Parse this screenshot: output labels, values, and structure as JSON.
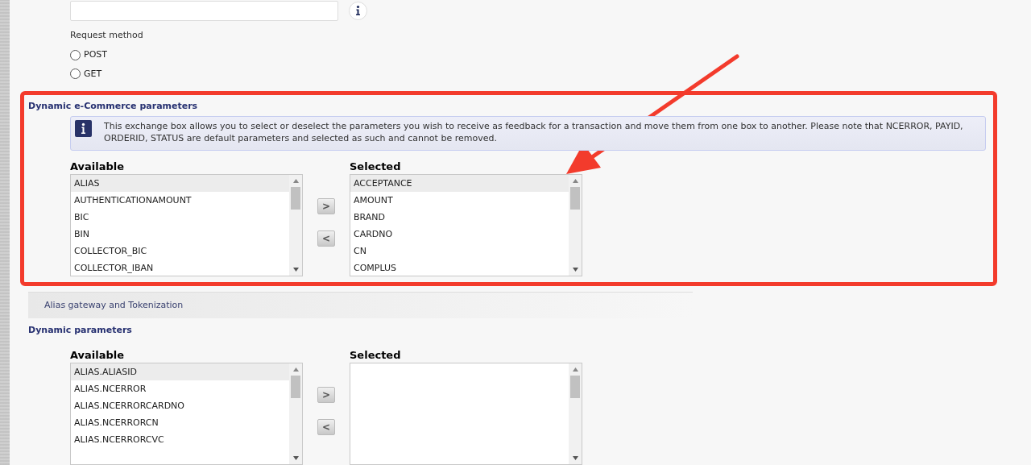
{
  "request_method": {
    "label": "Request method",
    "options": [
      {
        "label": "POST",
        "selected": false
      },
      {
        "label": "GET",
        "selected": false
      }
    ]
  },
  "ecommerce": {
    "title": "Dynamic e-Commerce parameters",
    "info": "This exchange box allows you to select or deselect the parameters you wish to receive as feedback for a transaction and move them from one box to another. Please note that NCERROR, PAYID, ORDERID, STATUS are default parameters and selected as such and cannot be removed.",
    "available": {
      "label": "Available",
      "items": [
        {
          "text": "ALIAS",
          "selected": true
        },
        {
          "text": "AUTHENTICATIONAMOUNT",
          "selected": false
        },
        {
          "text": "BIC",
          "selected": false
        },
        {
          "text": "BIN",
          "selected": false
        },
        {
          "text": "COLLECTOR_BIC",
          "selected": false
        },
        {
          "text": "COLLECTOR_IBAN",
          "selected": false
        }
      ]
    },
    "add_button": ">",
    "remove_button": "<",
    "selected_list": {
      "label": "Selected",
      "items": [
        {
          "text": "ACCEPTANCE",
          "selected": true
        },
        {
          "text": "AMOUNT",
          "selected": false
        },
        {
          "text": "BRAND",
          "selected": false
        },
        {
          "text": "CARDNO",
          "selected": false
        },
        {
          "text": "CN",
          "selected": false
        },
        {
          "text": "COMPLUS",
          "selected": false
        }
      ]
    }
  },
  "alias_tab": "Alias gateway and Tokenization",
  "dynamic": {
    "title": "Dynamic parameters",
    "available": {
      "label": "Available",
      "items": [
        {
          "text": "ALIAS.ALIASID",
          "selected": true
        },
        {
          "text": "ALIAS.NCERROR",
          "selected": false
        },
        {
          "text": "ALIAS.NCERRORCARDNO",
          "selected": false
        },
        {
          "text": "ALIAS.NCERRORCN",
          "selected": false
        },
        {
          "text": "ALIAS.NCERRORCVC",
          "selected": false
        }
      ]
    },
    "add_button": ">",
    "remove_button": "<",
    "selected_list": {
      "label": "Selected"
    }
  }
}
